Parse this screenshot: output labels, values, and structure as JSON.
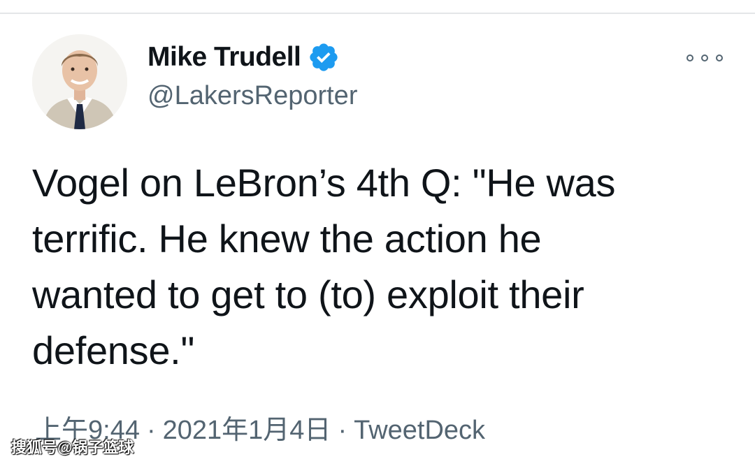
{
  "tweet": {
    "author": {
      "display_name": "Mike Trudell",
      "handle": "@LakersReporter",
      "verified": true
    },
    "text": "Vogel on LeBron’s 4th Q: \"He was\nterrific. He knew the action he\nwanted to get to (to) exploit their\ndefense.\"",
    "time": "上午9:44",
    "separator": "·",
    "date": "2021年1月4日",
    "source": "TweetDeck"
  },
  "icons": {
    "verified": "verified-badge-icon",
    "more": "more-options-icon"
  },
  "watermark": "搜狐号@锅子篮球",
  "colors": {
    "verified_blue": "#1d9bf0",
    "text_primary": "#0f1419",
    "text_secondary": "#536471"
  }
}
